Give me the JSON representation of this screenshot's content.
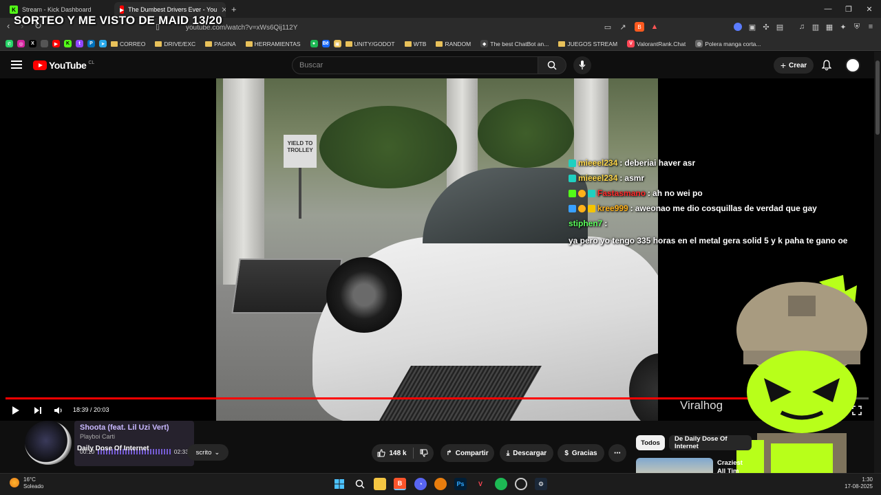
{
  "browser": {
    "tabs": [
      {
        "label": "Stream - Kick Dashboard",
        "favicon_color": "#53fc18",
        "active": false
      },
      {
        "label": "The Dumbest Drivers Ever - You",
        "favicon_color": "#ff0000",
        "active": true
      }
    ],
    "url": "youtube.com/watch?v=xWs6Qij112Y",
    "overlay_title": "SORTEO Y ME VISTO DE MAID 13/20",
    "bookmarks": [
      {
        "label": "CORREO",
        "type": "folder"
      },
      {
        "label": "DRIVE/EXC",
        "type": "folder"
      },
      {
        "label": "PAGINA",
        "type": "folder"
      },
      {
        "label": "HERRAMIENTAS",
        "type": "folder"
      },
      {
        "label": "UNITY/GODOT",
        "type": "folder"
      },
      {
        "label": "WTB",
        "type": "folder"
      },
      {
        "label": "RANDOM",
        "type": "folder"
      },
      {
        "label": "The best ChatBot an...",
        "type": "link"
      },
      {
        "label": "JUEGOS STREAM",
        "type": "folder"
      },
      {
        "label": "ValorantRank.Chat",
        "type": "link"
      },
      {
        "label": "Polera manga corta...",
        "type": "link"
      }
    ]
  },
  "youtube": {
    "logo_text": "YouTube",
    "country_code": "CL",
    "search_placeholder": "Buscar",
    "create_label": "Crear"
  },
  "player": {
    "time_current": "18:39",
    "time_total": "20:03",
    "time_label": "18:39 / 20:03",
    "progress_fraction": 0.93,
    "watermark": "Viralhog",
    "sign_text": "YIELD TO TROLLEY"
  },
  "chat": [
    {
      "user": "mieeel234",
      "user_color": "#ffd84a",
      "message": "deberiai haver asr"
    },
    {
      "user": "mieeel234",
      "user_color": "#ffd84a",
      "message": "asmr"
    },
    {
      "user": "Fastasmano",
      "user_color": "#ff2a2a",
      "message": "ah no wei po"
    },
    {
      "user": "kree999",
      "user_color": "#ffb21a",
      "message": "aweonao me dio cosquillas de verdad que gay"
    },
    {
      "user": "stiphen7",
      "user_color": "#5cff5c",
      "message": "ya pero yo tengo 335 horas en el metal gera solid 5 y k paha te gano oe"
    }
  ],
  "music": {
    "title": "Shoota (feat. Lil Uzi Vert)",
    "artist": "Playboi Carti",
    "elapsed": "00:10",
    "duration": "02:33"
  },
  "below": {
    "channel_name": "Daily Dose Of Internet",
    "subscribe_label": "scrito",
    "like_count": "148 k",
    "share_label": "Compartir",
    "download_label": "Descargar",
    "thanks_label": "Gracias",
    "chips": [
      "Todos",
      "De Daily Dose Of Internet"
    ],
    "reco_title": "Craziest\nAll Tim"
  },
  "taskbar": {
    "temp": "16°C",
    "weather": "Soleado",
    "time": "1:30",
    "date": "17-08-2025"
  },
  "colors": {
    "yt_red": "#ff0000",
    "mascot_green": "#b8ff1a",
    "music_accent": "#8a6cff"
  }
}
